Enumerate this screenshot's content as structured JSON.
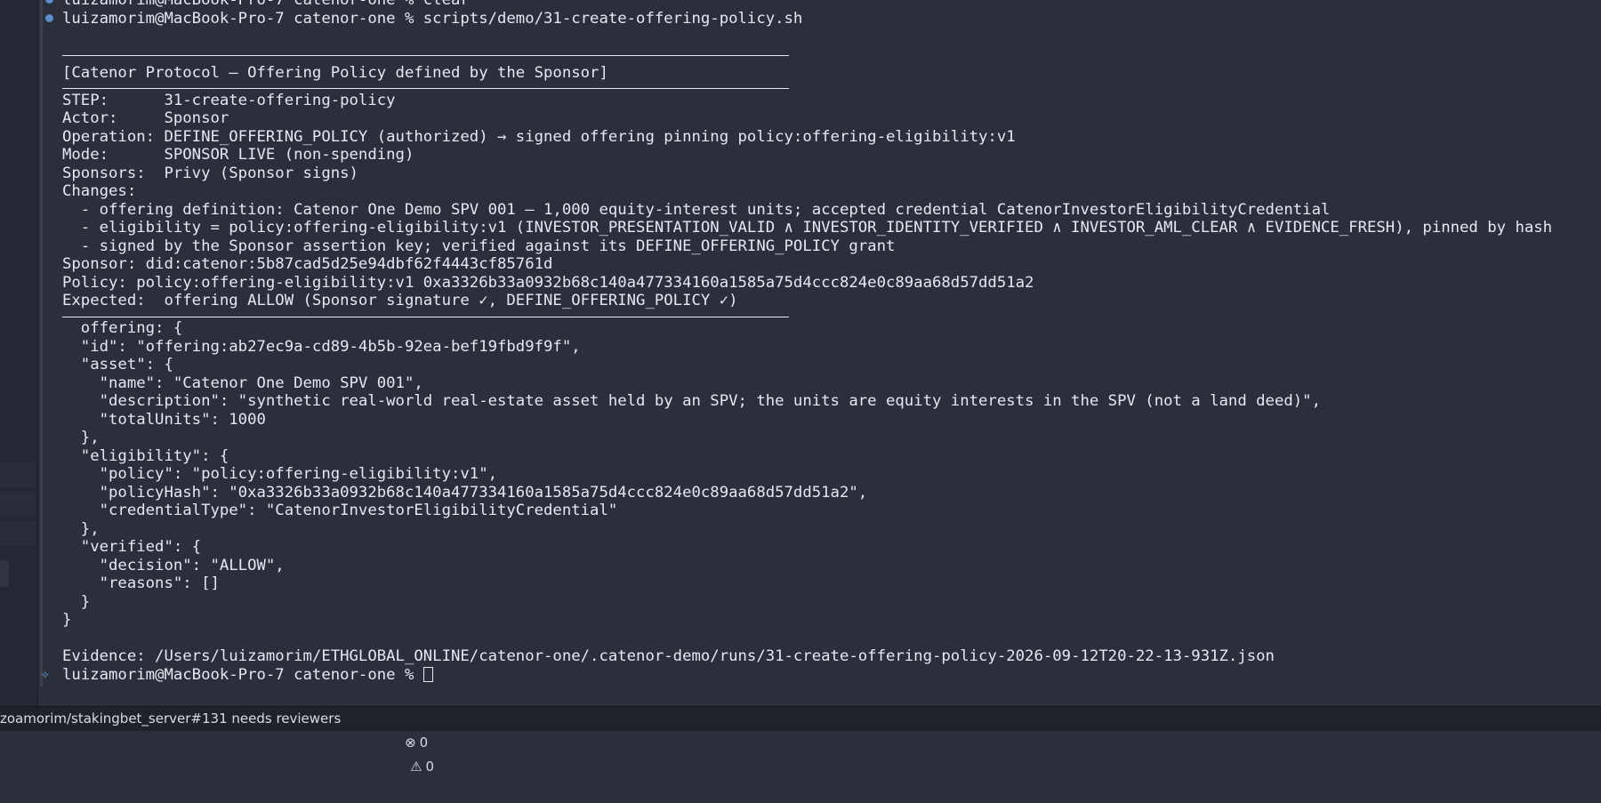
{
  "terminal": {
    "prompt_user_host": "luizamorim@MacBook-Pro-7",
    "prompt_dir": "catenor-one",
    "prompt_symbol": "%",
    "history": [
      {
        "command": "clear"
      },
      {
        "command": "scripts/demo/31-create-offering-policy.sh"
      }
    ],
    "banner_title": "[Catenor Protocol — Offering Policy defined by the Sponsor]",
    "header_lines": [
      "STEP:      31-create-offering-policy",
      "Actor:     Sponsor",
      "Operation: DEFINE_OFFERING_POLICY (authorized) → signed offering pinning policy:offering-eligibility:v1",
      "Mode:      SPONSOR LIVE (non-spending)",
      "Sponsors:  Privy (Sponsor signs)",
      "Changes:",
      "  - offering definition: Catenor One Demo SPV 001 — 1,000 equity-interest units; accepted credential CatenorInvestorEligibilityCredential",
      "  - eligibility = policy:offering-eligibility:v1 (INVESTOR_PRESENTATION_VALID ∧ INVESTOR_IDENTITY_VERIFIED ∧ INVESTOR_AML_CLEAR ∧ EVIDENCE_FRESH), pinned by hash",
      "  - signed by the Sponsor assertion key; verified against its DEFINE_OFFERING_POLICY grant",
      "Sponsor: did:catenor:5b87cad5d25e94dbf62f4443cf85761d",
      "Policy: policy:offering-eligibility:v1 0xa3326b33a0932b68c140a477334160a1585a75d4ccc824e0c89aa68d57dd51a2",
      "Expected:  offering ALLOW (Sponsor signature ✓, DEFINE_OFFERING_POLICY ✓)"
    ],
    "json_lines": [
      "  offering: {",
      "  \"id\": \"offering:ab27ec9a-cd89-4b5b-92ea-bef19fbd9f9f\",",
      "  \"asset\": {",
      "    \"name\": \"Catenor One Demo SPV 001\",",
      "    \"description\": \"synthetic real-world real-estate asset held by an SPV; the units are equity interests in the SPV (not a land deed)\",",
      "    \"totalUnits\": 1000",
      "  },",
      "  \"eligibility\": {",
      "    \"policy\": \"policy:offering-eligibility:v1\",",
      "    \"policyHash\": \"0xa3326b33a0932b68c140a477334160a1585a75d4ccc824e0c89aa68d57dd51a2\",",
      "    \"credentialType\": \"CatenorInvestorEligibilityCredential\"",
      "  },",
      "  \"verified\": {",
      "    \"decision\": \"ALLOW\",",
      "    \"reasons\": []",
      "  }",
      "}"
    ],
    "evidence_line": "Evidence: /Users/luizamorim/ETHGLOBAL_ONLINE/catenor-one/.catenor-demo/runs/31-create-offering-policy-2026-09-12T20-22-13-931Z.json"
  },
  "statusbar": {
    "branch_text": "zoamorim/stakingbet_server#131 needs reviewers",
    "errors_count": "0",
    "warnings_count": "0",
    "error_icon": "circle-x-icon",
    "warning_icon": "warning-triangle-icon"
  },
  "colors": {
    "background": "#2b2f3b",
    "text": "#e6e8ef",
    "dot": "#5b8bc9",
    "statusbar": "#1f222b"
  }
}
